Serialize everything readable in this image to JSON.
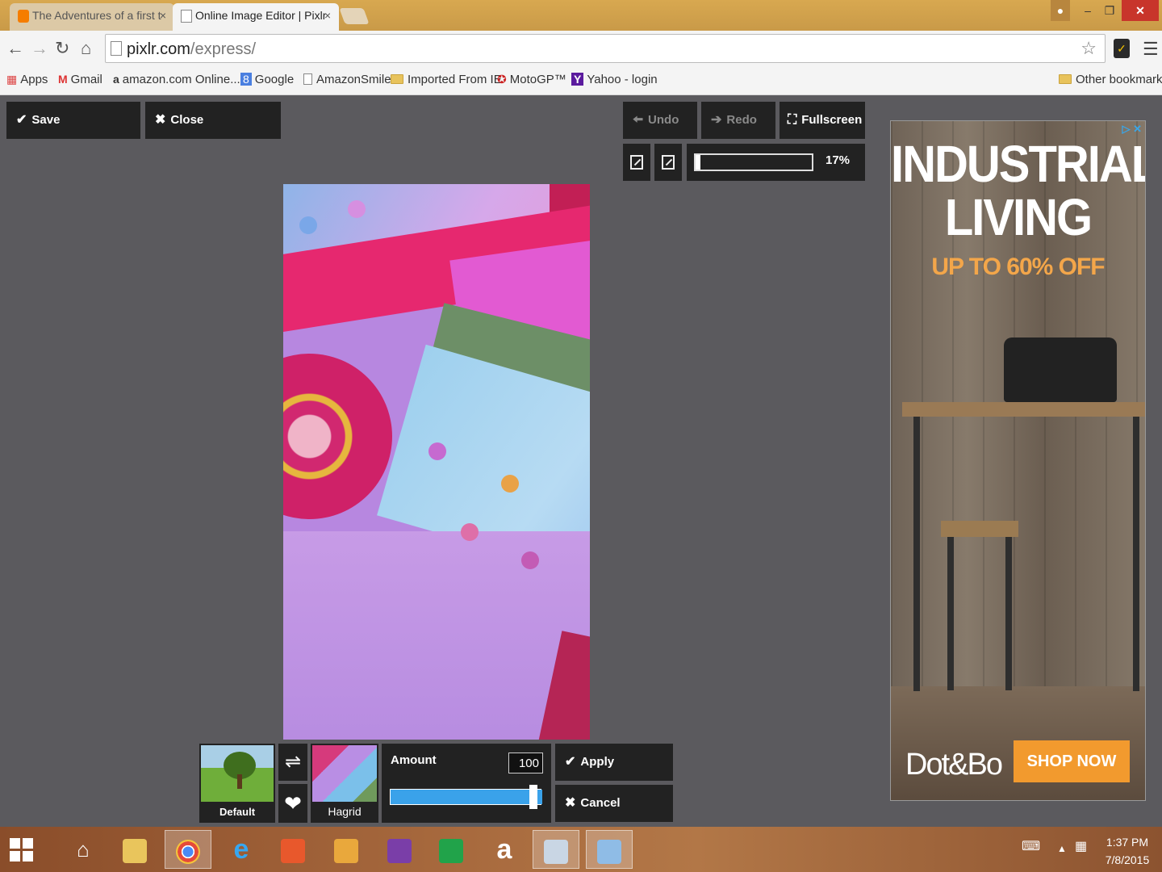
{
  "browser": {
    "tabs": [
      {
        "title": "The Adventures of a first t",
        "active": false
      },
      {
        "title": "Online Image Editor | Pixlr",
        "active": true
      }
    ],
    "close_glyph": "×",
    "url_host": "pixlr.com",
    "url_path": "/express/",
    "bookmarks": [
      {
        "label": "Apps",
        "icon": "apps-grid-icon"
      },
      {
        "label": "Gmail",
        "icon": "gmail-icon"
      },
      {
        "label": "amazon.com Online...",
        "icon": "amazon-icon"
      },
      {
        "label": "Google",
        "icon": "google-icon"
      },
      {
        "label": "AmazonSmile",
        "icon": "page-icon"
      },
      {
        "label": "Imported From IE",
        "icon": "folder-icon"
      },
      {
        "label": "MotoGP™",
        "icon": "motogp-icon"
      },
      {
        "label": "Yahoo - login",
        "icon": "yahoo-icon"
      }
    ],
    "other_bookmarks": "Other bookmarks"
  },
  "editor": {
    "save_label": "Save",
    "close_label": "Close",
    "undo_label": "Undo",
    "redo_label": "Redo",
    "fullscreen_label": "Fullscreen",
    "zoom_percent": 17,
    "zoom_label": "17%"
  },
  "effects": {
    "default_label": "Default",
    "current_label": "Hagrid",
    "amount_label": "Amount",
    "amount_value": "100",
    "amount_fraction": 1.0,
    "apply_label": "Apply",
    "cancel_label": "Cancel"
  },
  "ad": {
    "headline_1": "INDUSTRIAL",
    "headline_2": "LIVING",
    "offer": "UP TO 60% OFF",
    "brand": "Dot&Bo",
    "cta": "SHOP NOW",
    "adchoices": "▷ ✕",
    "colors": {
      "offer": "#f3a64a",
      "cta": "#f29a2e"
    }
  },
  "taskbar": {
    "time": "1:37 PM",
    "date": "7/8/2015"
  },
  "colors": {
    "app_bg": "#5b5a5e",
    "button_bg": "#222222",
    "slider_fill": "#3aa2ea",
    "close_button": "#c8352b"
  }
}
